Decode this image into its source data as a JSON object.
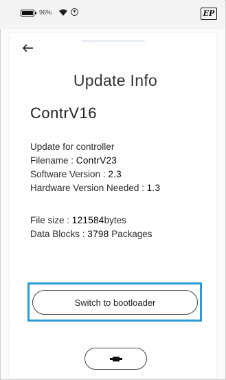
{
  "status_bar": {
    "battery_percent": "96%",
    "icons": [
      "battery-icon",
      "wifi-icon",
      "data-saver-icon",
      "ep-logo"
    ],
    "logo_text": "EP"
  },
  "nav": {
    "back_icon": "back-arrow-icon"
  },
  "page": {
    "title": "Update Info",
    "device_name": "ContrV16"
  },
  "info": {
    "update_for": "Update for controller",
    "filename_label": "Filename : ",
    "filename_value": "ContrV23",
    "software_label": "Software Version : ",
    "software_value": "2.3",
    "hardware_label": "Hardware Version Needed : ",
    "hardware_value": "1.3",
    "filesize_label": "File size : ",
    "filesize_value": "121584",
    "filesize_unit": "bytes",
    "blocks_label": "Data Blocks : ",
    "blocks_value": "3798",
    "blocks_unit": " Packages"
  },
  "actions": {
    "switch_label": "Switch to bootloader",
    "connect_icon": "connector-icon"
  },
  "colors": {
    "highlight": "#2b9bd6",
    "background": "#ffffff"
  }
}
